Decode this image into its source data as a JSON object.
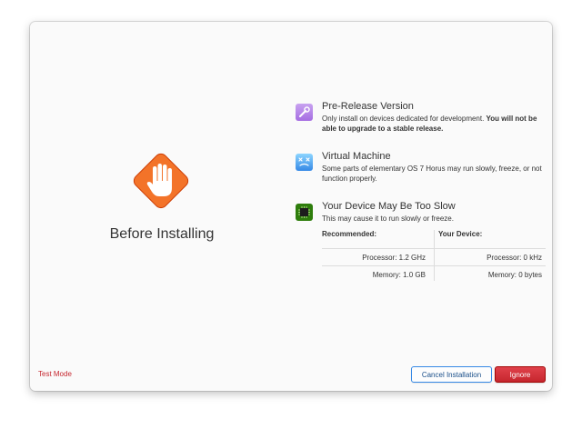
{
  "hero": {
    "title": "Before Installing",
    "icon": "stop-hand-icon"
  },
  "issues": [
    {
      "title": "Pre-Release Version",
      "desc": "Only install on devices dedicated for development. ",
      "desc_bold": "You will not be able to upgrade to a stable release.",
      "icon": "wrench-icon",
      "color": "#a56de2"
    },
    {
      "title": "Virtual Machine",
      "desc": "Some parts of elementary OS 7 Horus may run slowly, freeze, or not function properly.",
      "icon": "virtual-machine-icon",
      "color": "#3689e6"
    },
    {
      "title": "Your Device May Be Too Slow",
      "desc": "This may cause it to run slowly or freeze.",
      "icon": "processor-chip-icon",
      "color": "#3a9104"
    }
  ],
  "specs": {
    "recommended_header": "Recommended:",
    "device_header": "Your Device:",
    "rec_processor": "Processor: 1.2 GHz",
    "rec_memory": "Memory: 1.0 GB",
    "dev_processor": "Processor: 0 kHz",
    "dev_memory": "Memory: 0 bytes"
  },
  "footer": {
    "test_mode": "Test Mode",
    "cancel_label": "Cancel Installation",
    "ignore_label": "Ignore"
  },
  "colors": {
    "accent": "#3689e6",
    "destructive": "#c6262e",
    "hero": "#f37329"
  }
}
